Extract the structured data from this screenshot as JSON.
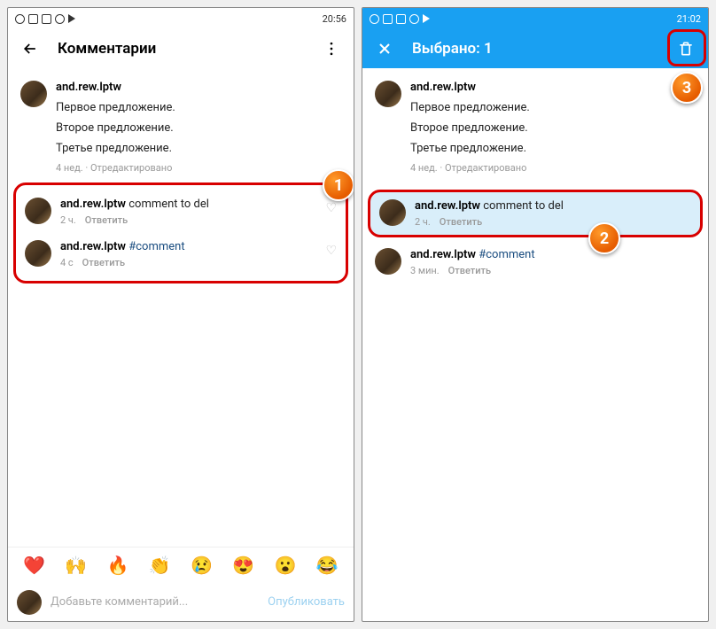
{
  "left": {
    "status_time": "20:56",
    "header_title": "Комментарии",
    "post": {
      "username": "and.rew.lptw",
      "lines": [
        "Первое предложение.",
        "Второе предложение.",
        "Третье предложение."
      ],
      "meta_time": "4 нед.",
      "meta_edited": "Отредактировано"
    },
    "comments": [
      {
        "username": "and.rew.lptw",
        "text": "comment to del",
        "hashtag": "",
        "time": "2 ч.",
        "reply": "Ответить"
      },
      {
        "username": "and.rew.lptw",
        "text": "",
        "hashtag": "#comment",
        "time": "4 с",
        "reply": "Ответить"
      }
    ],
    "emoji": [
      "❤️",
      "🙌",
      "🔥",
      "👏",
      "😢",
      "😍",
      "😮",
      "😂"
    ],
    "input_placeholder": "Добавьте комментарий...",
    "publish": "Опубликовать",
    "badge": "1"
  },
  "right": {
    "status_time": "21:02",
    "header_title": "Выбрано: 1",
    "post": {
      "username": "and.rew.lptw",
      "lines": [
        "Первое предложение.",
        "Второе предложение.",
        "Третье предложение."
      ],
      "meta_time": "4 нед.",
      "meta_edited": "Отредактировано"
    },
    "comments": [
      {
        "username": "and.rew.lptw",
        "text": "comment to del",
        "hashtag": "",
        "time": "2 ч.",
        "reply": "Ответить"
      },
      {
        "username": "and.rew.lptw",
        "text": "",
        "hashtag": "#comment",
        "time": "3 мин.",
        "reply": "Ответить"
      }
    ],
    "badge2": "2",
    "badge3": "3"
  }
}
